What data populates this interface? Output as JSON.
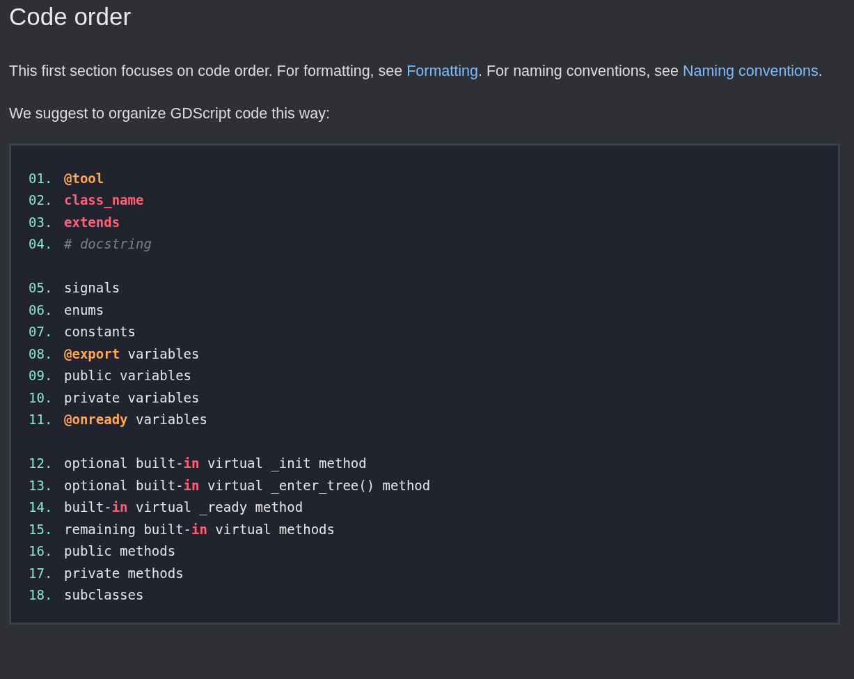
{
  "heading": "Code order",
  "paragraphs": [
    [
      {
        "kind": "text",
        "text": "This first section focuses on code order. For formatting, see "
      },
      {
        "kind": "link",
        "text": "Formatting"
      },
      {
        "kind": "text",
        "text": ". For naming conventions, see "
      },
      {
        "kind": "link",
        "text": "Naming conventions"
      },
      {
        "kind": "text",
        "text": "."
      }
    ],
    [
      {
        "kind": "text",
        "text": "We suggest to organize GDScript code this way:"
      }
    ]
  ],
  "code_block": {
    "groups": [
      [
        {
          "number": "01.",
          "tokens": [
            {
              "kind": "decorator",
              "text": "@tool"
            }
          ]
        },
        {
          "number": "02.",
          "tokens": [
            {
              "kind": "keyword",
              "text": "class_name"
            }
          ]
        },
        {
          "number": "03.",
          "tokens": [
            {
              "kind": "keyword",
              "text": "extends"
            }
          ]
        },
        {
          "number": "04.",
          "tokens": [
            {
              "kind": "comment",
              "text": "# docstring"
            }
          ]
        }
      ],
      [
        {
          "number": "05.",
          "tokens": [
            {
              "kind": "plain",
              "text": "signals"
            }
          ]
        },
        {
          "number": "06.",
          "tokens": [
            {
              "kind": "plain",
              "text": "enums"
            }
          ]
        },
        {
          "number": "07.",
          "tokens": [
            {
              "kind": "plain",
              "text": "constants"
            }
          ]
        },
        {
          "number": "08.",
          "tokens": [
            {
              "kind": "decorator",
              "text": "@export"
            },
            {
              "kind": "plain",
              "text": " variables"
            }
          ]
        },
        {
          "number": "09.",
          "tokens": [
            {
              "kind": "plain",
              "text": "public variables"
            }
          ]
        },
        {
          "number": "10.",
          "tokens": [
            {
              "kind": "plain",
              "text": "private variables"
            }
          ]
        },
        {
          "number": "11.",
          "tokens": [
            {
              "kind": "decorator",
              "text": "@onready"
            },
            {
              "kind": "plain",
              "text": " variables"
            }
          ]
        }
      ],
      [
        {
          "number": "12.",
          "tokens": [
            {
              "kind": "plain",
              "text": "optional built-"
            },
            {
              "kind": "keyword",
              "text": "in"
            },
            {
              "kind": "plain",
              "text": " virtual _init method"
            }
          ]
        },
        {
          "number": "13.",
          "tokens": [
            {
              "kind": "plain",
              "text": "optional built-"
            },
            {
              "kind": "keyword",
              "text": "in"
            },
            {
              "kind": "plain",
              "text": " virtual _enter_tree() method"
            }
          ]
        },
        {
          "number": "14.",
          "tokens": [
            {
              "kind": "plain",
              "text": "built-"
            },
            {
              "kind": "keyword",
              "text": "in"
            },
            {
              "kind": "plain",
              "text": " virtual _ready method"
            }
          ]
        },
        {
          "number": "15.",
          "tokens": [
            {
              "kind": "plain",
              "text": "remaining built-"
            },
            {
              "kind": "keyword",
              "text": "in"
            },
            {
              "kind": "plain",
              "text": " virtual methods"
            }
          ]
        },
        {
          "number": "16.",
          "tokens": [
            {
              "kind": "plain",
              "text": "public methods"
            }
          ]
        },
        {
          "number": "17.",
          "tokens": [
            {
              "kind": "plain",
              "text": "private methods"
            }
          ]
        },
        {
          "number": "18.",
          "tokens": [
            {
              "kind": "plain",
              "text": "subclasses"
            }
          ]
        }
      ]
    ]
  }
}
